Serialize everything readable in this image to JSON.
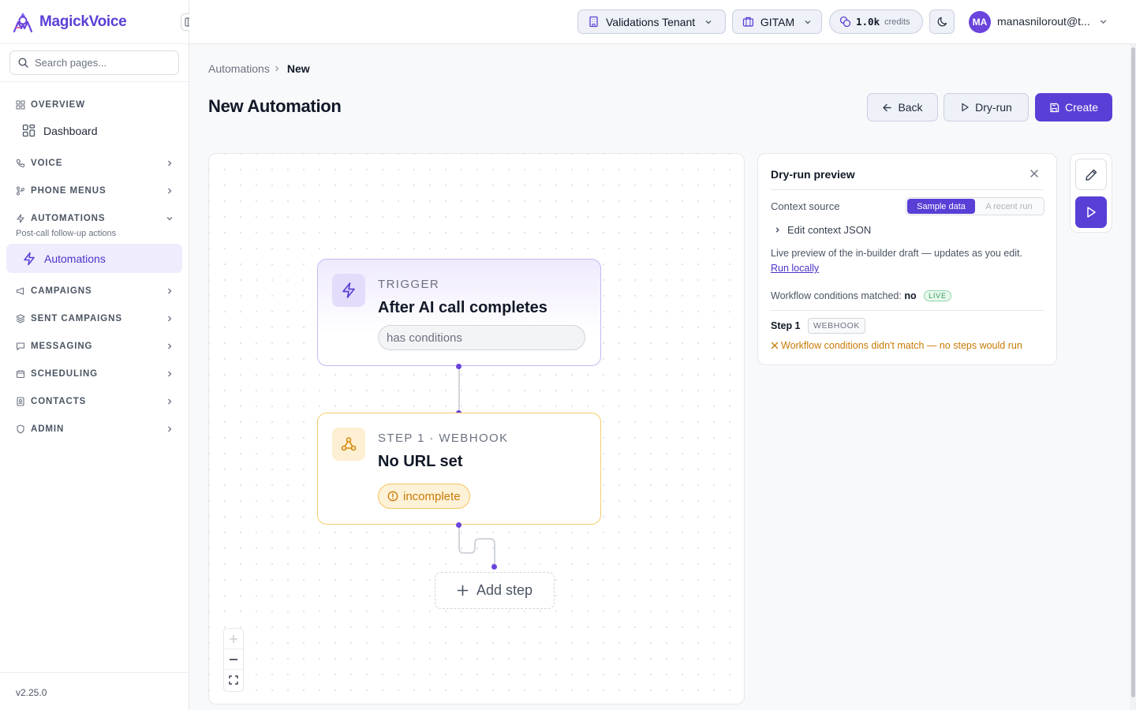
{
  "app": {
    "name": "MagickVoice",
    "version": "v2.25.0"
  },
  "sidebar": {
    "search_placeholder": "Search pages...",
    "overview": {
      "label": "OVERVIEW",
      "items": [
        {
          "label": "Dashboard"
        }
      ]
    },
    "sections": {
      "voice": "VOICE",
      "phone_menus": "PHONE MENUS",
      "automations": "AUTOMATIONS",
      "automations_sub": "Post-call follow-up actions",
      "automations_item": "Automations",
      "campaigns": "CAMPAIGNS",
      "sent_campaigns": "SENT CAMPAIGNS",
      "messaging": "MESSAGING",
      "scheduling": "SCHEDULING",
      "contacts": "CONTACTS",
      "admin": "ADMIN"
    }
  },
  "topbar": {
    "tenant": "Validations Tenant",
    "org": "GITAM",
    "credits_value": "1.0k",
    "credits_label": "credits",
    "avatar_initials": "MA",
    "user": "manasnilorout@t..."
  },
  "breadcrumb": {
    "parent": "Automations",
    "current": "New"
  },
  "page": {
    "title": "New Automation",
    "buttons": {
      "back": "Back",
      "dry_run": "Dry-run",
      "create": "Create"
    }
  },
  "canvas": {
    "trigger": {
      "kicker": "TRIGGER",
      "title": "After AI call completes",
      "chip": "has conditions"
    },
    "step": {
      "kicker": "STEP 1 · WEBHOOK",
      "title": "No URL set",
      "chip": "incomplete"
    },
    "add_step": "Add step"
  },
  "dry_run": {
    "title": "Dry-run preview",
    "context_label": "Context source",
    "options": [
      "Sample data",
      "A recent run"
    ],
    "selected": "Sample data",
    "edit_json": "Edit context JSON",
    "description": "Live preview of the in-builder draft — updates as you edit.",
    "run_locally": "Run locally",
    "conditions_label": "Workflow conditions matched:",
    "conditions_value": "no",
    "live_badge": "LIVE",
    "step_label": "Step 1",
    "step_type": "WEBHOOK",
    "warning": "Workflow conditions didn't match — no steps would run"
  },
  "colors": {
    "accent": "#5a3fd6",
    "warning": "#c97a06",
    "success": "#2e9d57"
  }
}
